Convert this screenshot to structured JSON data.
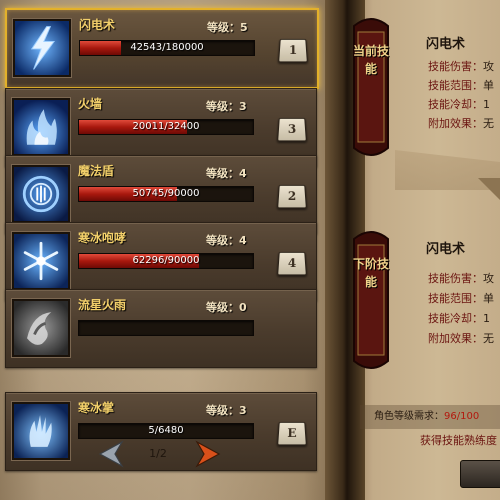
{
  "skills": [
    {
      "name": "闪电术",
      "level_label": "等级：5",
      "progress_text": "42543/180000",
      "progress": 0.236,
      "hotkey": "1",
      "icon": "lightning-skill-icon",
      "selected": true
    },
    {
      "name": "火墙",
      "level_label": "等级：3",
      "progress_text": "20011/32400",
      "progress": 0.618,
      "hotkey": "3",
      "icon": "firewall-skill-icon",
      "selected": false
    },
    {
      "name": "魔法盾",
      "level_label": "等级：4",
      "progress_text": "50745/90000",
      "progress": 0.564,
      "hotkey": "2",
      "icon": "magic-shield-skill-icon",
      "selected": false
    },
    {
      "name": "寒冰咆哮",
      "level_label": "等级：4",
      "progress_text": "62296/90000",
      "progress": 0.692,
      "hotkey": "4",
      "icon": "ice-roar-skill-icon",
      "selected": false
    },
    {
      "name": "流星火雨",
      "level_label": "等级：0",
      "progress_text": "",
      "progress": 0,
      "hotkey": "",
      "icon": "meteor-rain-skill-icon",
      "selected": false
    },
    {
      "name": "寒冰掌",
      "level_label": "等级：3",
      "progress_text": "5/6480",
      "progress": 0.001,
      "hotkey": "E",
      "icon": "ice-palm-skill-icon",
      "selected": false
    }
  ],
  "pager": {
    "indicator": "1/2"
  },
  "current_panel": {
    "banner": "当前技能",
    "title": "闪电术",
    "lines": [
      {
        "label": "技能伤害：",
        "value": "攻"
      },
      {
        "label": "技能范围：",
        "value": "单"
      },
      {
        "label": "技能冷却：",
        "value": "1"
      },
      {
        "label": "附加效果：",
        "value": "无"
      }
    ]
  },
  "next_panel": {
    "banner": "下阶技能",
    "title": "闪电术",
    "lines": [
      {
        "label": "技能伤害：",
        "value": "攻"
      },
      {
        "label": "技能范围：",
        "value": "单"
      },
      {
        "label": "技能冷却：",
        "value": "1"
      },
      {
        "label": "附加效果：",
        "value": "无"
      }
    ]
  },
  "requirement": {
    "label": "角色等级需求：",
    "value": "96/100"
  },
  "gain_text": "获得技能熟练度",
  "colors": {
    "accent": "#e3b12a",
    "bar_red": "#a8180e",
    "label_red": "#6b1410"
  }
}
